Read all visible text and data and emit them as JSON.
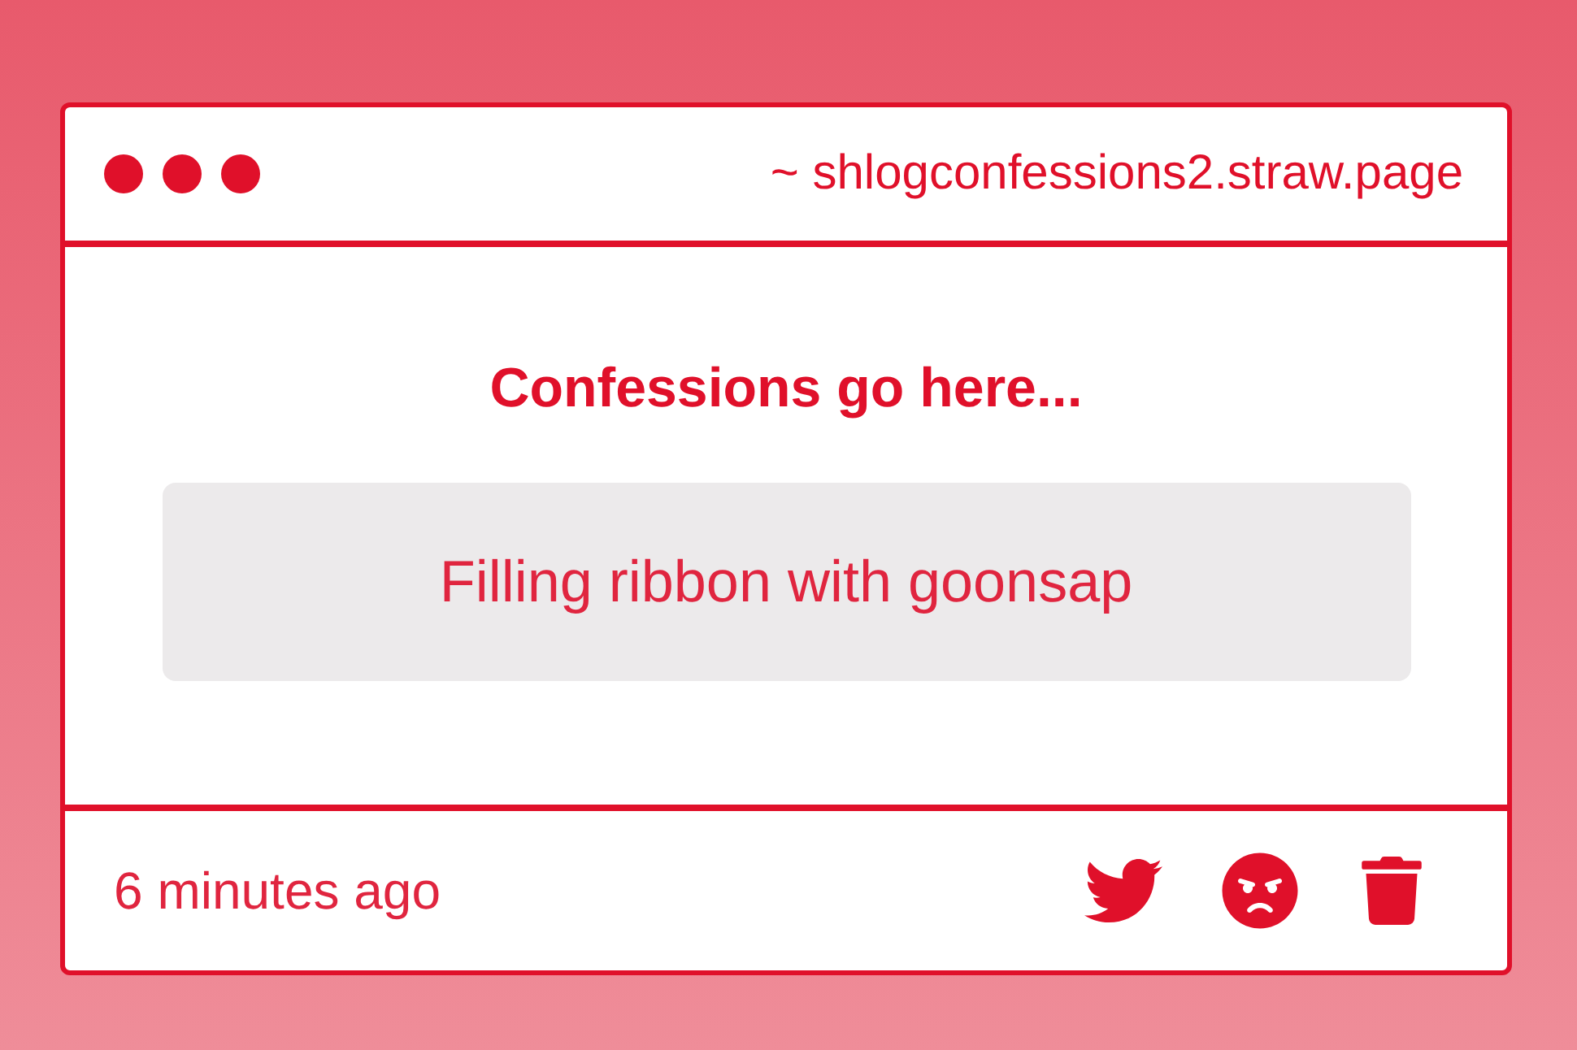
{
  "window": {
    "address": "~ shlogconfessions2.straw.page"
  },
  "card": {
    "title": "Confessions go here...",
    "message": "Filling ribbon with goonsap"
  },
  "footer": {
    "time": "6 minutes ago"
  }
}
